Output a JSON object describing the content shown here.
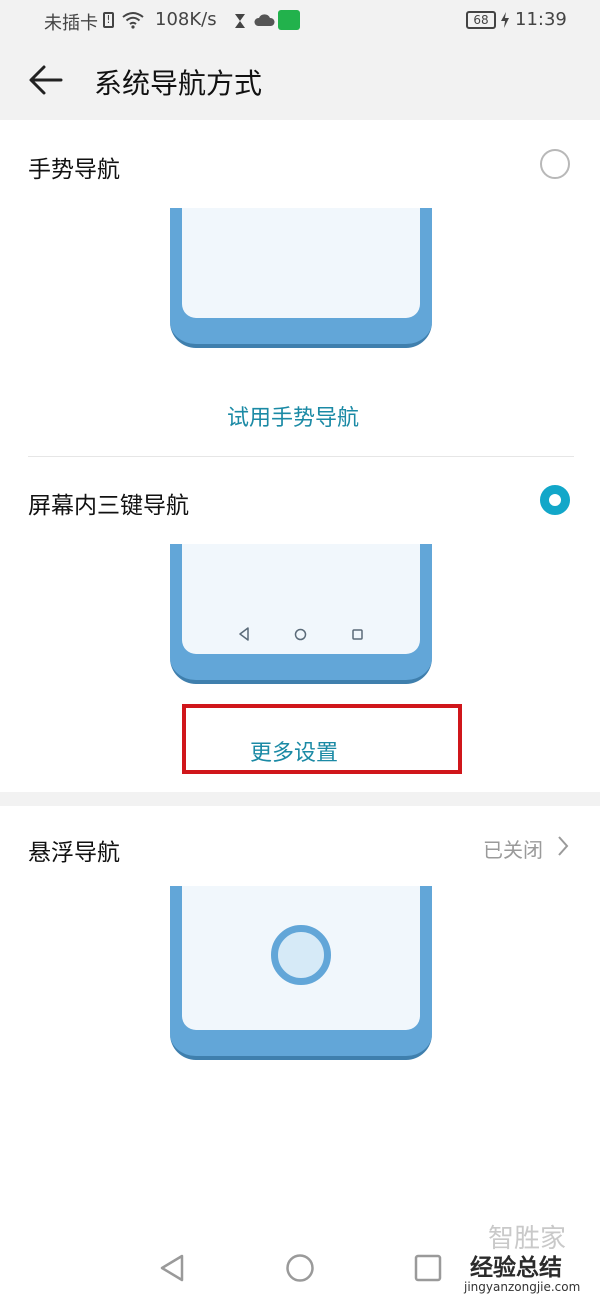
{
  "status_bar": {
    "carrier": "未插卡",
    "speed": "108K/s",
    "battery": "68",
    "time": "11:39"
  },
  "header": {
    "title": "系统导航方式"
  },
  "sections": {
    "gesture": {
      "title": "手势导航",
      "try_link": "试用手势导航",
      "selected": false
    },
    "three_key": {
      "title": "屏幕内三键导航",
      "more_link": "更多设置",
      "selected": true
    },
    "floating": {
      "title": "悬浮导航",
      "status": "已关闭"
    }
  },
  "watermark": {
    "top": "智胜家",
    "main": "经验总结",
    "url": "jingyanzongjie.com"
  },
  "colors": {
    "accent": "#12a7c9",
    "link": "#1b8aa5",
    "illustration": "#62a6d8",
    "highlight_box": "#d0161b"
  },
  "icons": [
    "back-arrow-icon",
    "wifi-icon",
    "cloud-icon",
    "battery-icon",
    "chevron-right-icon",
    "nav-back-icon",
    "nav-home-icon",
    "nav-recent-icon"
  ]
}
